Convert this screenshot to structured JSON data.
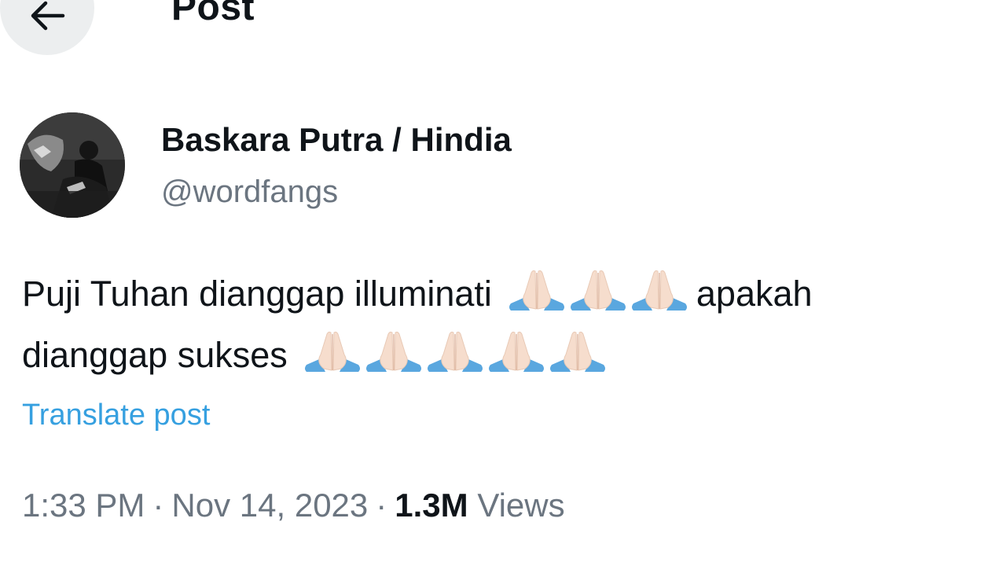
{
  "header": {
    "back_icon": "arrow-left-icon",
    "title": "Post"
  },
  "author": {
    "display_name": "Baskara Putra / Hindia",
    "handle": "@wordfangs",
    "avatar": "avatar-photo"
  },
  "post": {
    "line1_text": "Puji Tuhan dianggap illuminati",
    "line1_emoji_count": 3,
    "line1_suffix": "apakah",
    "line2_text": "dianggap sukses",
    "line2_emoji_count": 5,
    "emoji_icon": "folded-hands-icon",
    "translate_label": "Translate post"
  },
  "meta": {
    "time": "1:33 PM",
    "separator": "·",
    "date": "Nov 14, 2023",
    "views_count": "1.3M",
    "views_label": "Views"
  },
  "colors": {
    "text": "#0f1419",
    "secondary": "#6b7580",
    "link": "#36a0e0",
    "back_button_bg": "#eceeef",
    "emoji_sleeve": "#5aa7df",
    "emoji_hand": "#f6ddcd"
  }
}
